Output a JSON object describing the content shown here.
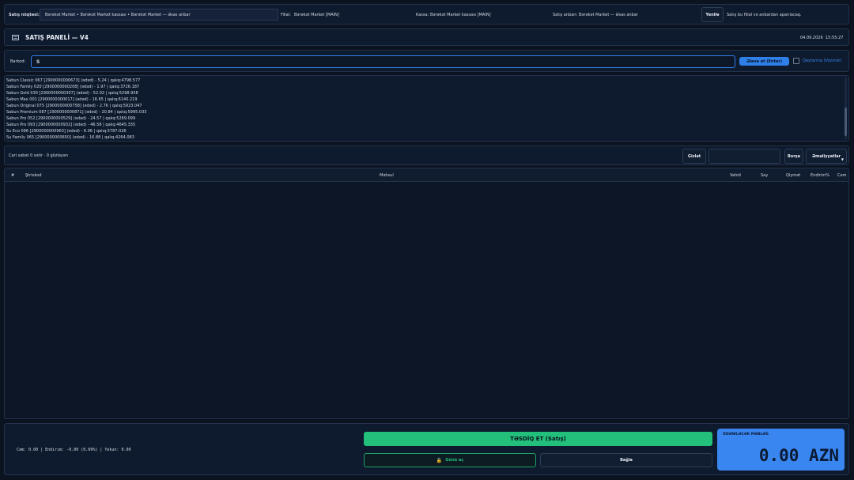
{
  "top": {
    "point_label": "Satış nöqtəsi:",
    "point_value": "Bərəkət Market • Bərəkət Market kassası • Bərəkət Market — Əsas anbar",
    "branch_label": "Filial:",
    "branch_value": "Bərəkət Market [MAIN]",
    "kassa_label": "Kassa:",
    "kassa_value": "Bərəkət Market kassası [MAIN]",
    "warehouse_label": "Satış anbarı:",
    "warehouse_value": "Bərəkət Market — Əsas anbar",
    "refresh_label": "Yenilə",
    "hint": "Satış bu filial və anbardan aparılacaq."
  },
  "header": {
    "icon": "register-icon",
    "title": "SATIŞ PANELİ — V4",
    "date": "04.09.2026",
    "time": "15:55:27"
  },
  "barcode": {
    "label": "Barkod:",
    "value": "S",
    "add_button": "Əlavə et (Enter)",
    "return_label": "Qaytarma (Vozvrat)"
  },
  "suggestions": [
    "Sabun Classic 067  [2900000000673]  (ədəd) - 5.24  |  qalıq:4798.577",
    "Sabun Family 020  [2900000000208]  (ədəd) - 1.97  |  qalıq:3726.187",
    "Sabun Gold 030  [2900000000307]  (ədəd) - 52.02  |  qalıq:5298.958",
    "Sabun Max 001  [2900000000017]  (ədəd) - 16.65  |  qalıq:6140.219",
    "Sabun Original 075  [2900000000758]  (ədəd) - 2.76  |  qalıq:5923.047",
    "Sabun Premium 087  [2900000000871]  (ədəd) - 20.84  |  qalıq:5995.033",
    "Sabun Pro 052  [2900000000529]  (ədəd) - 24.57  |  qalıq:5269.099",
    "Sabun Pro 093  [2900000000932]  (ədəd) - 46.58  |  qalıq:4645.335",
    "Su Eco 096  [2900000000963]  (ədəd) - 6.06  |  qalıq:5787.026",
    "Su Family 065  [2900000000650]  (ədəd) - 16.88  |  qalıq:4264.083"
  ],
  "cart_bar": {
    "status": "Cari səbət 0 sətir · 0 gözləyən",
    "hold_button": "Gizlət",
    "return_button": "Borşa",
    "operations_button": "Əməliyyatlar"
  },
  "table": {
    "headers": [
      "#",
      "Ştrixkod",
      "Məhsul",
      "Vahid",
      "Say",
      "Qiymət",
      "Endirim%",
      "Cəm"
    ]
  },
  "footer": {
    "summary": "Cəm: 0.00 | Endirim: -0.00 (0.00%) | Yekun: 0.00",
    "confirm_button": "TƏSDİQ ET (Satış)",
    "shift_button": "Günü aç",
    "close_button": "Bağla",
    "total_label": "ÖDƏNİLƏCƏK MƏBLƏĞ",
    "total_value": "0.00 AZN"
  },
  "colors": {
    "accent": "#2f7fe8",
    "confirm": "#22c07a",
    "total_box": "#3a86f0"
  }
}
